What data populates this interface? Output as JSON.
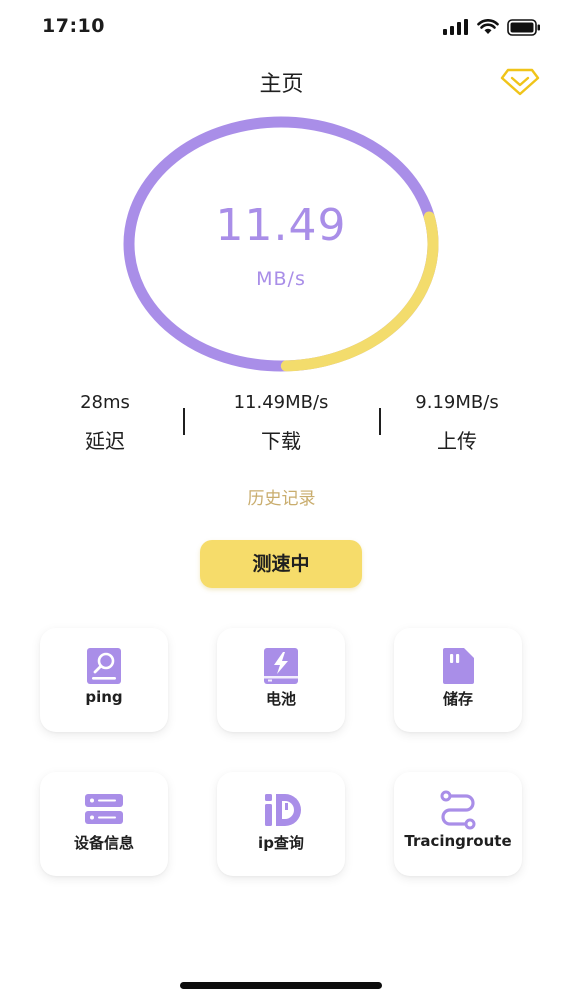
{
  "status_bar": {
    "time": "17:10"
  },
  "header": {
    "title": "主页"
  },
  "gauge": {
    "value": "11.49",
    "unit": "MB/s",
    "progress_fraction": 0.28,
    "track_color": "#a98ee8",
    "progress_color": "#f3dc6c"
  },
  "stats": [
    {
      "value": "28ms",
      "label": "延迟"
    },
    {
      "value": "11.49MB/s",
      "label": "下载"
    },
    {
      "value": "9.19MB/s",
      "label": "上传"
    }
  ],
  "history_label": "历史记录",
  "test_button_label": "测速中",
  "tools": [
    {
      "label": "ping",
      "icon": "magnifier-doc-icon"
    },
    {
      "label": "电池",
      "icon": "battery-bolt-icon"
    },
    {
      "label": "储存",
      "icon": "sd-card-icon"
    },
    {
      "label": "设备信息",
      "icon": "server-icon"
    },
    {
      "label": "ip查询",
      "icon": "ip-icon"
    },
    {
      "label": "Tracingroute",
      "icon": "route-icon"
    }
  ],
  "colors": {
    "accent_purple": "#a98ee8",
    "accent_yellow": "#f6dc6a",
    "history_gold": "#c9ad6e"
  }
}
